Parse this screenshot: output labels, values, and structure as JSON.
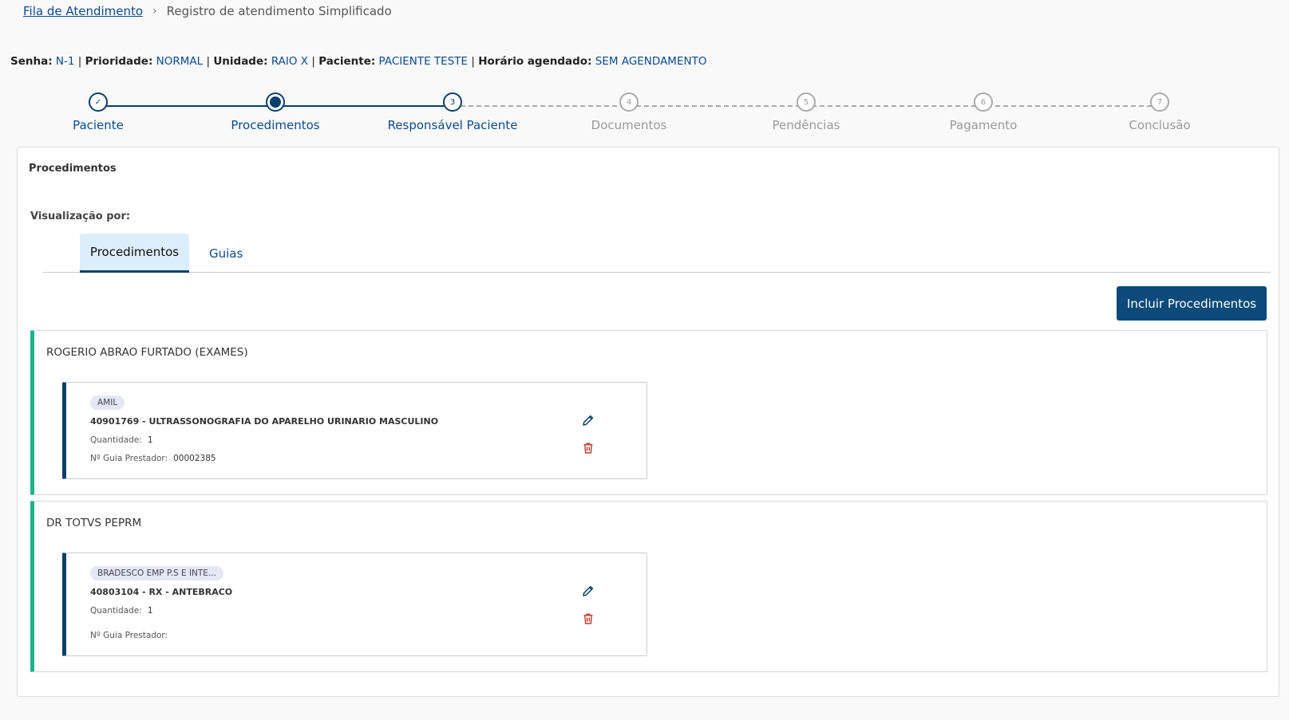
{
  "breadcrumb": {
    "link": "Fila de Atendimento",
    "separator": "›",
    "current": "Registro de atendimento Simplificado"
  },
  "info": {
    "senha_label": "Senha:",
    "senha": "N-1",
    "prioridade_label": "Prioridade:",
    "prioridade": "NORMAL",
    "unidade_label": "Unidade:",
    "unidade": "RAIO X",
    "paciente_label": "Paciente:",
    "paciente": "PACIENTE TESTE",
    "horario_label": "Horário agendado:",
    "horario": "SEM AGENDAMENTO",
    "separator": "|"
  },
  "stepper": {
    "steps": [
      {
        "number": "✓",
        "label": "Paciente",
        "status": "done"
      },
      {
        "number": "",
        "label": "Procedimentos",
        "status": "active"
      },
      {
        "number": "3",
        "label": "Responsável Paciente",
        "status": "next"
      },
      {
        "number": "4",
        "label": "Documentos",
        "status": "todo"
      },
      {
        "number": "5",
        "label": "Pendências",
        "status": "todo"
      },
      {
        "number": "6",
        "label": "Pagamento",
        "status": "todo"
      },
      {
        "number": "7",
        "label": "Conclusão",
        "status": "todo"
      }
    ]
  },
  "panel": {
    "title": "Procedimentos",
    "view_label": "Visualização por:",
    "tabs": [
      {
        "label": "Procedimentos",
        "active": true
      },
      {
        "label": "Guias",
        "active": false
      }
    ],
    "add_button": "Incluir Procedimentos"
  },
  "groups": [
    {
      "title": "ROGERIO ABRAO FURTADO (EXAMES)",
      "card": {
        "insurer": "AMIL",
        "procedure": "40901769 - ULTRASSONOGRAFIA DO APARELHO URINARIO MASCULINO",
        "quantity_label": "Quantidade:",
        "quantity": "1",
        "guide_label": "Nº Guia Prestador:",
        "guide": "00002385"
      }
    },
    {
      "title": "DR TOTVS PEPRM",
      "card": {
        "insurer": "BRADESCO EMP P.S E INTE...",
        "procedure": "40803104 - RX - ANTEBRACO",
        "quantity_label": "Quantidade:",
        "quantity": "1",
        "guide_label": "Nº Guia Prestador:",
        "guide": ""
      }
    }
  ],
  "colors": {
    "primary": "#0c3f6b",
    "link": "#0c4a8a",
    "accent_green": "#1db38a",
    "delete_red": "#c0392b"
  }
}
